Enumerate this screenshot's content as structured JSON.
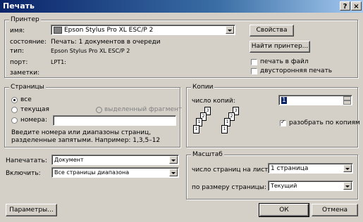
{
  "window": {
    "title": "Печать",
    "help_btn": "?",
    "close_btn": "×"
  },
  "printer": {
    "group_label": "Принтер",
    "name_label": "имя:",
    "name_value": "Epson Stylus Pro XL ESC/P 2",
    "status_label": "состояние:",
    "status_value": "Печать: 1 документов в очереди",
    "type_label": "тип:",
    "type_value": "Epson Stylus Pro XL ESC/P 2",
    "port_label": "порт:",
    "port_value": "LPT1:",
    "notes_label": "заметки:",
    "properties_btn": "Свойства",
    "find_btn": "Найти принтер...",
    "print_to_file": "печать в файл",
    "duplex": "двусторонняя печать"
  },
  "pages": {
    "group_label": "Страницы",
    "all": "все",
    "current": "текущая",
    "selection": "выделенный фрагмент",
    "numbers": "номера:",
    "numbers_value": "",
    "hint": "Введите номера или диапазоны страниц, разделенные запятыми. Например: 1,3,5–12"
  },
  "copies": {
    "group_label": "Копии",
    "count_label": "число копий:",
    "count_value": "1",
    "collate": "разобрать по копиям"
  },
  "scale": {
    "group_label": "Масштаб",
    "per_sheet_label": "число страниц на листе:",
    "per_sheet_value": "1 страница",
    "fit_label": "по размеру страницы:",
    "fit_value": "Текущий"
  },
  "print_what": {
    "label": "Напечатать:",
    "value": "Документ"
  },
  "include": {
    "label": "Включить:",
    "value": "Все страницы диапазона"
  },
  "buttons": {
    "params": "Параметры...",
    "ok": "ОК",
    "cancel": "Отмена"
  }
}
